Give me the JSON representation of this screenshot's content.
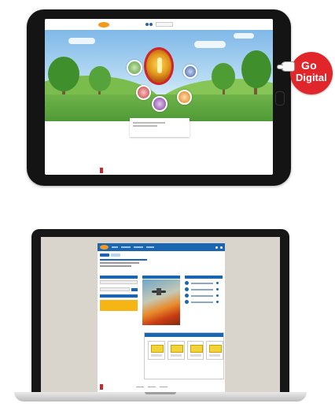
{
  "tablet": {
    "site": {
      "logo_text": "",
      "nav_items": [
        "",
        "",
        "",
        ""
      ],
      "hero_card_title": "",
      "footer_text": "",
      "footer_links": [
        "",
        "",
        ""
      ]
    }
  },
  "badge": {
    "line1": "Go",
    "line2": "Digital",
    "color": "#e0262b"
  },
  "laptop": {
    "site": {
      "brand_color": "#1b66b3",
      "accent_color": "#f5b515",
      "tabs": [
        "",
        ""
      ],
      "footer_text": ""
    }
  },
  "icons": {
    "hand": "pointing-hand-icon",
    "publisher_logo": "publisher-logo"
  }
}
